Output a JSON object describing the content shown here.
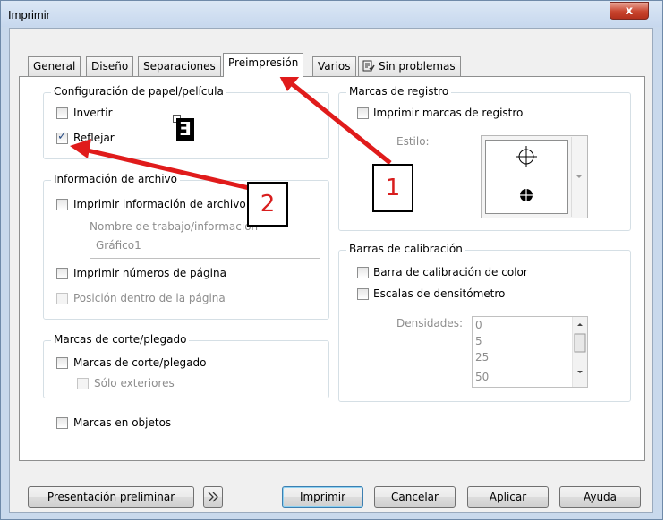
{
  "window": {
    "title": "Imprimir",
    "close_glyph": "x"
  },
  "tabs": [
    "General",
    "Diseño",
    "Separaciones",
    "Preimpresión",
    "Varios",
    "Sin problemas"
  ],
  "active_tab": "Preimpresión",
  "paper": {
    "legend": "Configuración de papel/película",
    "invert_label": "Invertir",
    "invert_checked": false,
    "mirror_label": "Reflejar",
    "mirror_checked": true,
    "preview_glyph": "E"
  },
  "fileinfo": {
    "legend": "Información de archivo",
    "print_info_label": "Imprimir información de archivo",
    "job_name_label": "Nombre de trabajo/información",
    "job_name_value": "Gráfico1",
    "page_numbers_label": "Imprimir números de página",
    "position_label": "Posición dentro de la página"
  },
  "crop": {
    "legend": "Marcas de corte/plegado",
    "marks_label": "Marcas de corte/plegado",
    "exterior_label": "Sólo exteriores"
  },
  "object_marks_label": "Marcas en objetos",
  "registration": {
    "legend": "Marcas de registro",
    "print_label": "Imprimir marcas de registro",
    "style_label": "Estilo:"
  },
  "calibration": {
    "legend": "Barras de calibración",
    "color_bar_label": "Barra de calibración de color",
    "densitometer_label": "Escalas de densitómetro",
    "densities_label": "Densidades:",
    "densities": [
      "0",
      "5",
      "25",
      "50"
    ]
  },
  "buttons": {
    "preview": "Presentación preliminar",
    "print": "Imprimir",
    "cancel": "Cancelar",
    "apply": "Aplicar",
    "help": "Ayuda"
  },
  "callouts": [
    "1",
    "2"
  ],
  "colors": {
    "annotation": "#e01b1b",
    "checkmark": "#2c4f86"
  }
}
